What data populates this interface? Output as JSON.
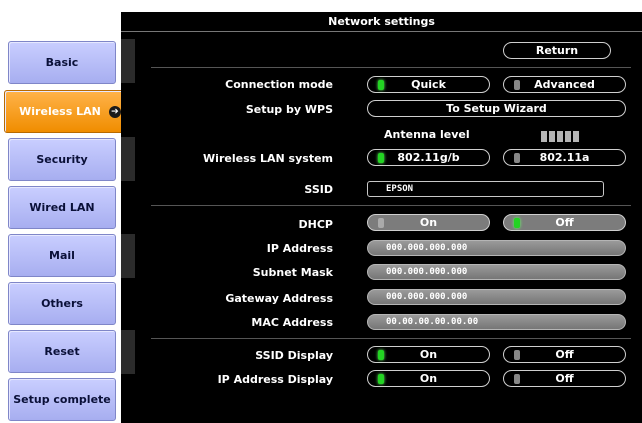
{
  "nav": [
    {
      "label": "Basic"
    },
    {
      "label": "Wireless LAN",
      "active": true
    },
    {
      "label": "Security"
    },
    {
      "label": "Wired LAN"
    },
    {
      "label": "Mail"
    },
    {
      "label": "Others"
    },
    {
      "label": "Reset"
    },
    {
      "label": "Setup complete"
    }
  ],
  "title": "Network settings",
  "return_label": "Return",
  "connection_mode": {
    "label": "Connection mode",
    "options": [
      "Quick",
      "Advanced"
    ],
    "selected": "Quick"
  },
  "wps": {
    "label": "Setup by WPS",
    "button": "To Setup Wizard"
  },
  "antenna": {
    "label": "Antenna level",
    "bars": 5
  },
  "wlan_system": {
    "label": "Wireless LAN system",
    "options": [
      "802.11g/b",
      "802.11a"
    ],
    "selected": "802.11g/b"
  },
  "ssid": {
    "label": "SSID",
    "value": "EPSON"
  },
  "dhcp": {
    "label": "DHCP",
    "options": [
      "On",
      "Off"
    ],
    "selected": "Off"
  },
  "ip": {
    "label": "IP Address",
    "value": "000.000.000.000"
  },
  "subnet": {
    "label": "Subnet Mask",
    "value": "000.000.000.000"
  },
  "gateway": {
    "label": "Gateway Address",
    "value": "000.000.000.000"
  },
  "mac": {
    "label": "MAC Address",
    "value": "00.00.00.00.00.00"
  },
  "ssid_display": {
    "label": "SSID Display",
    "options": [
      "On",
      "Off"
    ],
    "selected": "On"
  },
  "ip_display": {
    "label": "IP Address Display",
    "options": [
      "On",
      "Off"
    ],
    "selected": "On"
  },
  "colors": {
    "active_tab": "#f08d00",
    "nav_tab": "#b6bcf6",
    "panel": "#000000",
    "led_on": "#23d423"
  }
}
